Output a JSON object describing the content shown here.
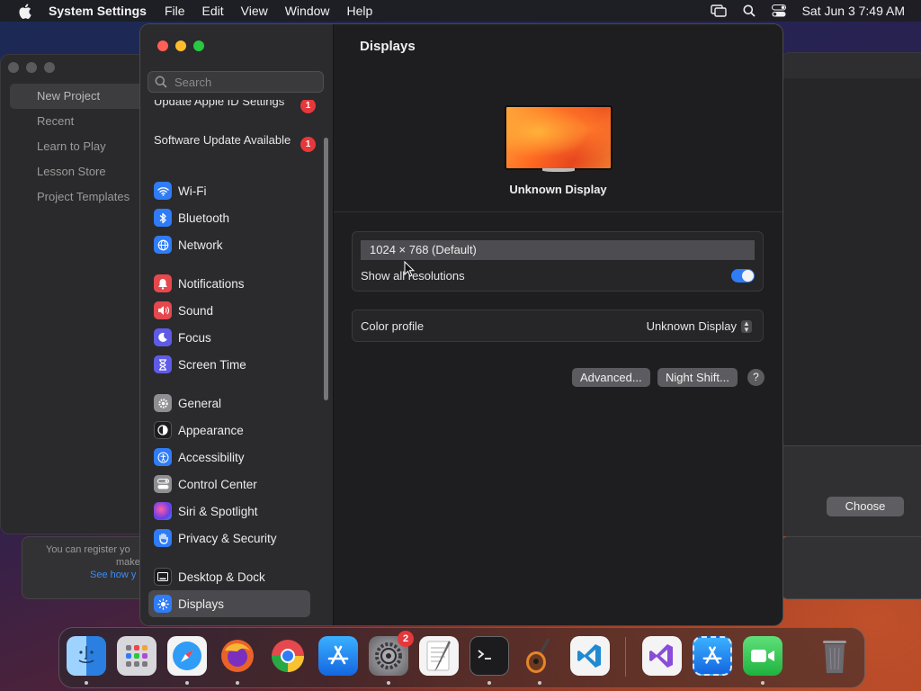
{
  "menubar": {
    "app_name": "System Settings",
    "menus": [
      "File",
      "Edit",
      "View",
      "Window",
      "Help"
    ],
    "datetime": "Sat Jun 3  7:49 AM"
  },
  "background_window": {
    "items": [
      "New Project",
      "Recent",
      "Learn to Play",
      "Lesson Store",
      "Project Templates"
    ],
    "note_line1": "You can register yo",
    "note_line2": "make",
    "note_link": "See how y",
    "choose_label": "Choose"
  },
  "sidebar": {
    "search_placeholder": "Search",
    "alerts": [
      {
        "label": "Update Apple ID Settings",
        "badge": "1"
      },
      {
        "label": "Software Update Available",
        "badge": "1"
      }
    ],
    "items": [
      {
        "label": "Wi-Fi",
        "icon": "wifi-icon",
        "color": "#2f7cf6"
      },
      {
        "label": "Bluetooth",
        "icon": "bluetooth-icon",
        "color": "#2f7cf6"
      },
      {
        "label": "Network",
        "icon": "globe-icon",
        "color": "#2f7cf6"
      },
      {
        "label": "Notifications",
        "icon": "bell-icon",
        "color": "#e5484d"
      },
      {
        "label": "Sound",
        "icon": "speaker-icon",
        "color": "#e5484d"
      },
      {
        "label": "Focus",
        "icon": "moon-icon",
        "color": "#5e5ce6"
      },
      {
        "label": "Screen Time",
        "icon": "hourglass-icon",
        "color": "#5e5ce6"
      },
      {
        "label": "General",
        "icon": "gear-icon",
        "color": "#8e8e93"
      },
      {
        "label": "Appearance",
        "icon": "appearance-icon",
        "color": "#1c1c1e"
      },
      {
        "label": "Accessibility",
        "icon": "accessibility-icon",
        "color": "#2f7cf6"
      },
      {
        "label": "Control Center",
        "icon": "control-center-icon",
        "color": "#8e8e93"
      },
      {
        "label": "Siri & Spotlight",
        "icon": "siri-icon",
        "color": "#b04ad8"
      },
      {
        "label": "Privacy & Security",
        "icon": "hand-icon",
        "color": "#2f7cf6"
      },
      {
        "label": "Desktop & Dock",
        "icon": "dock-icon",
        "color": "#1c1c1e"
      },
      {
        "label": "Displays",
        "icon": "sun-icon",
        "color": "#2f7cf6"
      }
    ],
    "selected": "Displays"
  },
  "content": {
    "title": "Displays",
    "display_name": "Unknown Display",
    "resolution": "1024 × 768 (Default)",
    "show_all_label": "Show all resolutions",
    "show_all_on": true,
    "color_profile_label": "Color profile",
    "color_profile_value": "Unknown Display",
    "advanced_button": "Advanced...",
    "night_shift_button": "Night Shift...",
    "help_button": "?"
  },
  "dock": {
    "apps": [
      {
        "name": "Finder",
        "icon": "finder-icon",
        "color": "#3a8ff0",
        "running": true
      },
      {
        "name": "Launchpad",
        "icon": "launchpad-icon",
        "color": "#d8d8dc",
        "running": false
      },
      {
        "name": "Safari",
        "icon": "safari-icon",
        "color": "#2f9cf5",
        "running": true
      },
      {
        "name": "Firefox",
        "icon": "firefox-icon",
        "color": "#e8632a",
        "running": true
      },
      {
        "name": "Chrome",
        "icon": "chrome-icon",
        "color": "#f2f2f2",
        "running": false
      },
      {
        "name": "App Store",
        "icon": "app-store-icon",
        "color": "#1d8ff5",
        "running": false
      },
      {
        "name": "System Settings",
        "icon": "settings-icon",
        "color": "#8e8e93",
        "running": true,
        "badge": "2"
      },
      {
        "name": "TextEdit",
        "icon": "textedit-icon",
        "color": "#f2f2f2",
        "running": false
      },
      {
        "name": "Terminal",
        "icon": "terminal-icon",
        "color": "#1c1c1e",
        "running": true
      },
      {
        "name": "GarageBand",
        "icon": "guitar-icon",
        "color": "#6b3a1e",
        "running": true
      },
      {
        "name": "Visual Studio Code",
        "icon": "vscode-icon",
        "color": "#f4f4f4",
        "running": false
      },
      {
        "name": "Visual Studio",
        "icon": "visual-studio-icon",
        "color": "#f4f4f4",
        "running": false
      },
      {
        "name": "Xcode Installer",
        "icon": "app-store-icon",
        "color": "#1d8ff5",
        "running": false
      },
      {
        "name": "FaceTime",
        "icon": "facetime-icon",
        "color": "#2fc24a",
        "running": true
      },
      {
        "name": "Trash",
        "icon": "trash-icon",
        "color": "#5a5a5e",
        "running": false
      }
    ]
  },
  "colors": {
    "accent": "#2f7cf6",
    "badge": "#e5383b",
    "traffic_close": "#fe5f57",
    "traffic_min": "#febc2e",
    "traffic_max": "#28c840"
  }
}
